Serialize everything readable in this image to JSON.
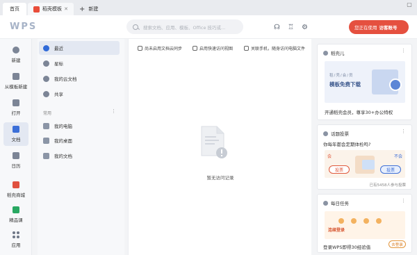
{
  "tabs": [
    {
      "label": "首页"
    },
    {
      "label": "稻壳模板"
    }
  ],
  "new_tab": {
    "label": "新建"
  },
  "window_controls": [
    "restore-icon",
    "minimize-icon",
    "maximize-icon"
  ],
  "header": {
    "logo": "WPS",
    "search_placeholder": "搜索文档、应用、模板、Office 技巧或...",
    "vip_text": "您正在使用",
    "vip_account": "访客账号",
    "icons": [
      "headset-icon",
      "shirt-icon",
      "settings-icon"
    ]
  },
  "rail": [
    {
      "label": "新建",
      "icon": "plus-circle-icon"
    },
    {
      "label": "从模板新建",
      "icon": "template-icon"
    },
    {
      "label": "打开",
      "icon": "folder-icon"
    },
    {
      "label": "文档",
      "icon": "document-icon",
      "active": true
    },
    {
      "label": "日历",
      "icon": "calendar-icon"
    },
    {
      "label": "稻壳商城",
      "icon": "docer-store-icon"
    },
    {
      "label": "精品课",
      "icon": "course-icon"
    },
    {
      "label": "应用",
      "icon": "apps-grid-icon"
    }
  ],
  "nav": {
    "items": [
      {
        "label": "最近",
        "icon": "clock-icon",
        "active": true
      },
      {
        "label": "星标",
        "icon": "star-icon"
      },
      {
        "label": "我的云文档",
        "icon": "cloud-icon"
      },
      {
        "label": "共享",
        "icon": "share-icon"
      }
    ],
    "section": "常用",
    "section_items": [
      {
        "label": "我的电脑",
        "icon": "computer-icon"
      },
      {
        "label": "我的桌面",
        "icon": "desktop-icon"
      },
      {
        "label": "我的文档",
        "icon": "folder-icon"
      }
    ]
  },
  "main": {
    "quick_actions": [
      {
        "label": "尚未启用文档云同步",
        "icon": "cloud-sync-icon"
      },
      {
        "label": "启用快速访问视图",
        "icon": "quick-access-icon"
      },
      {
        "label": "关联手机，随身访问电脑文件",
        "icon": "phone-icon"
      }
    ],
    "empty_text": "暂无访问记录"
  },
  "cards": {
    "docer": {
      "title": "稻壳儿",
      "banner_line1": "稻/壳/会/员",
      "banner_line2": "模板免费下载",
      "promo": "开通稻壳会员，尊享30+办公特权"
    },
    "poll": {
      "title": "话题投票",
      "question": "你每年都会定期体检吗?",
      "yes_side": "会",
      "no_side": "不会",
      "vote_label_1": "投票",
      "vote_label_2": "投票",
      "count": "已有5458人参与投票"
    },
    "task": {
      "title": "每日任务",
      "banner_text": "连续登录",
      "line": "登录WPS即得30经验值",
      "button": "去登录"
    }
  }
}
